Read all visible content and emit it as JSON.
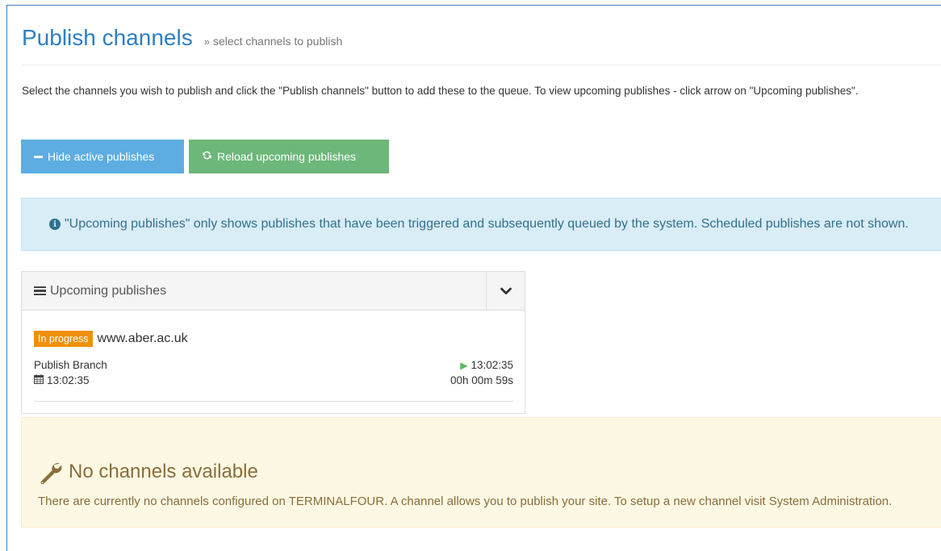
{
  "header": {
    "title": "Publish channels",
    "subtitle_glyph": "»",
    "subtitle": "select channels to publish"
  },
  "intro_text": "Select the channels you wish to publish and click the \"Publish channels\" button to add these to the queue. To view upcoming publishes - click arrow on \"Upcoming publishes\".",
  "buttons": {
    "hide_label": "Hide active publishes",
    "reload_label": "Reload upcoming publishes"
  },
  "info_alert": {
    "text": "\"Upcoming publishes\" only shows publishes that have been triggered and subsequently queued by the system. Scheduled publishes are not shown."
  },
  "upcoming_panel": {
    "title": "Upcoming publishes",
    "items": [
      {
        "status": "In progress",
        "site": "www.aber.ac.uk",
        "type": "Publish Branch",
        "scheduled_time": "13:02:35",
        "start_time": "13:02:35",
        "duration": "00h 00m 59s"
      }
    ]
  },
  "warning_alert": {
    "title": "No channels available",
    "text": "There are currently no channels configured on TERMINALFOUR. A channel allows you to publish your site. To setup a new channel visit System Administration."
  },
  "colors": {
    "title_blue": "#2f7fc1",
    "btn_info": "#5dade2",
    "btn_success": "#6cb779",
    "badge_orange": "#f0900c",
    "info_bg": "#d9edf7",
    "warning_bg": "#fcf8e3"
  },
  "icons": {
    "hide_button": "minus-icon",
    "reload_button": "refresh-icon",
    "info_alert": "info-circle-icon",
    "panel": "list-icon",
    "toggle": "chevron-down-icon",
    "start": "play-icon",
    "schedule": "calendar-icon",
    "warning": "wrench-icon"
  }
}
